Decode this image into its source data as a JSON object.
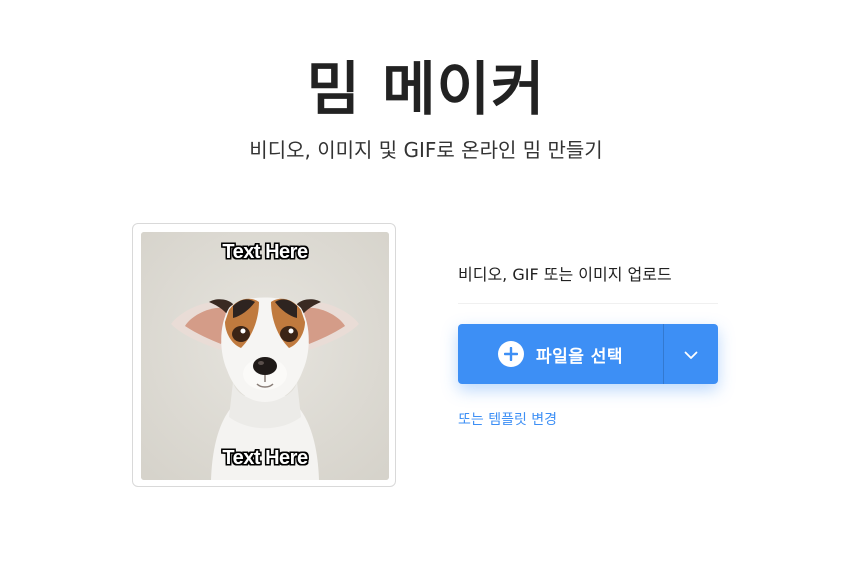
{
  "header": {
    "title": "밈 메이커",
    "subtitle": "비디오, 이미지 및 GIF로 온라인 밈 만들기"
  },
  "preview": {
    "top_text": "Text Here",
    "bottom_text": "Text Here"
  },
  "upload": {
    "label": "비디오, GIF 또는 이미지 업로드",
    "button_label": "파일을 선택",
    "button_icon": "plus-circle-icon",
    "dropdown_icon": "chevron-down-icon",
    "template_link": "또는 템플릿 변경"
  },
  "colors": {
    "accent": "#3d8ff5",
    "title": "#222222",
    "image_bg": "#dedbd4"
  }
}
